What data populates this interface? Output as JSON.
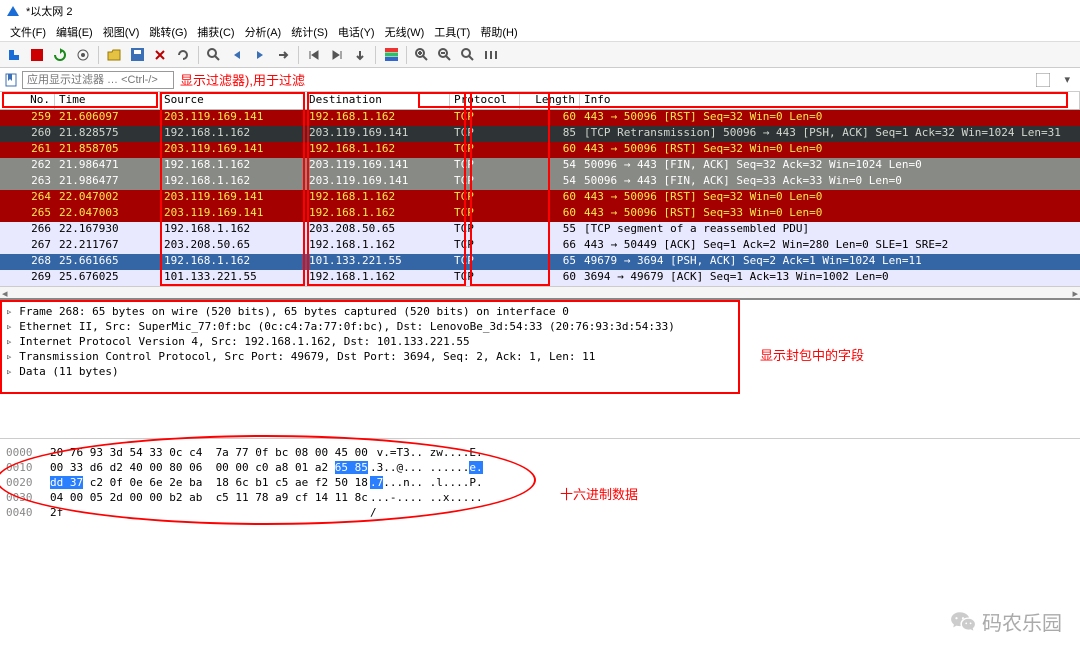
{
  "title": "*以太网 2",
  "menu": [
    "文件(F)",
    "编辑(E)",
    "视图(V)",
    "跳转(G)",
    "捕获(C)",
    "分析(A)",
    "统计(S)",
    "电话(Y)",
    "无线(W)",
    "工具(T)",
    "帮助(H)"
  ],
  "filter": {
    "placeholder": "应用显示过滤器 … <Ctrl-/>"
  },
  "annotation_filter": "显示过滤器),用于过滤",
  "annotation_fields": "显示封包中的字段",
  "annotation_hex": "十六进制数据",
  "columns": [
    "No.",
    "Time",
    "Source",
    "Destination",
    "Protocol",
    "Length",
    "Info"
  ],
  "packets": [
    {
      "no": "259",
      "time": "21.606097",
      "src": "203.119.169.141",
      "dst": "192.168.1.162",
      "proto": "TCP",
      "len": "60",
      "info": "443 → 50096 [RST] Seq=32 Win=0 Len=0",
      "style": "row-red-dark"
    },
    {
      "no": "260",
      "time": "21.828575",
      "src": "192.168.1.162",
      "dst": "203.119.169.141",
      "proto": "TCP",
      "len": "85",
      "info": "[TCP Retransmission] 50096 → 443 [PSH, ACK] Seq=1 Ack=32 Win=1024 Len=31",
      "style": "row-grey-dark"
    },
    {
      "no": "261",
      "time": "21.858705",
      "src": "203.119.169.141",
      "dst": "192.168.1.162",
      "proto": "TCP",
      "len": "60",
      "info": "443 → 50096 [RST] Seq=32 Win=0 Len=0",
      "style": "row-red-dark"
    },
    {
      "no": "262",
      "time": "21.986471",
      "src": "192.168.1.162",
      "dst": "203.119.169.141",
      "proto": "TCP",
      "len": "54",
      "info": "50096 → 443 [FIN, ACK] Seq=32 Ack=32 Win=1024 Len=0",
      "style": "row-grey"
    },
    {
      "no": "263",
      "time": "21.986477",
      "src": "192.168.1.162",
      "dst": "203.119.169.141",
      "proto": "TCP",
      "len": "54",
      "info": "50096 → 443 [FIN, ACK] Seq=33 Ack=33 Win=0 Len=0",
      "style": "row-grey"
    },
    {
      "no": "264",
      "time": "22.047002",
      "src": "203.119.169.141",
      "dst": "192.168.1.162",
      "proto": "TCP",
      "len": "60",
      "info": "443 → 50096 [RST] Seq=32 Win=0 Len=0",
      "style": "row-red-dark"
    },
    {
      "no": "265",
      "time": "22.047003",
      "src": "203.119.169.141",
      "dst": "192.168.1.162",
      "proto": "TCP",
      "len": "60",
      "info": "443 → 50096 [RST] Seq=33 Win=0 Len=0",
      "style": "row-red-dark"
    },
    {
      "no": "266",
      "time": "22.167930",
      "src": "192.168.1.162",
      "dst": "203.208.50.65",
      "proto": "TCP",
      "len": "55",
      "info": "[TCP segment of a reassembled PDU]",
      "style": "row-lav"
    },
    {
      "no": "267",
      "time": "22.211767",
      "src": "203.208.50.65",
      "dst": "192.168.1.162",
      "proto": "TCP",
      "len": "66",
      "info": "443 → 50449 [ACK] Seq=1 Ack=2 Win=280 Len=0 SLE=1 SRE=2",
      "style": "row-lav"
    },
    {
      "no": "268",
      "time": "25.661665",
      "src": "192.168.1.162",
      "dst": "101.133.221.55",
      "proto": "TCP",
      "len": "65",
      "info": "49679 → 3694 [PSH, ACK] Seq=2 Ack=1 Win=1024 Len=11",
      "style": "row-sel"
    },
    {
      "no": "269",
      "time": "25.676025",
      "src": "101.133.221.55",
      "dst": "192.168.1.162",
      "proto": "TCP",
      "len": "60",
      "info": "3694 → 49679 [ACK] Seq=1 Ack=13 Win=1002 Len=0",
      "style": "row-lav"
    }
  ],
  "details": [
    "Frame 268: 65 bytes on wire (520 bits), 65 bytes captured (520 bits) on interface 0",
    "Ethernet II, Src: SuperMic_77:0f:bc (0c:c4:7a:77:0f:bc), Dst: LenovoBe_3d:54:33 (20:76:93:3d:54:33)",
    "Internet Protocol Version 4, Src: 192.168.1.162, Dst: 101.133.221.55",
    "Transmission Control Protocol, Src Port: 49679, Dst Port: 3694, Seq: 2, Ack: 1, Len: 11",
    "Data (11 bytes)"
  ],
  "hex": [
    {
      "off": "0000",
      "b1": "20 76 93 3d 54 33 0c c4  7a 77 0f bc 08 00 45 00",
      "asc": " v.=T3.. zw....E."
    },
    {
      "off": "0010",
      "b1": "00 33 d6 d2 40 00 80 06  00 00 c0 a8 01 a2 ",
      "hl1": "65 85",
      "asc": ".3..@... ......",
      "aschl": "e."
    },
    {
      "off": "0020",
      "b1hl": "dd 37",
      "b1": " c2 0f 0e 6e 2e ba  18 6c b1 c5 ae f2 50 18",
      "aschl": ".7",
      "asc": "...n.. .l....P."
    },
    {
      "off": "0030",
      "b1": "04 00 05 2d 00 00 b2 ab  c5 11 78 a9 cf 14 11 8c",
      "asc": "...-.... ..x....."
    },
    {
      "off": "0040",
      "b1": "2f",
      "asc": "/"
    }
  ],
  "watermark": "码农乐园"
}
